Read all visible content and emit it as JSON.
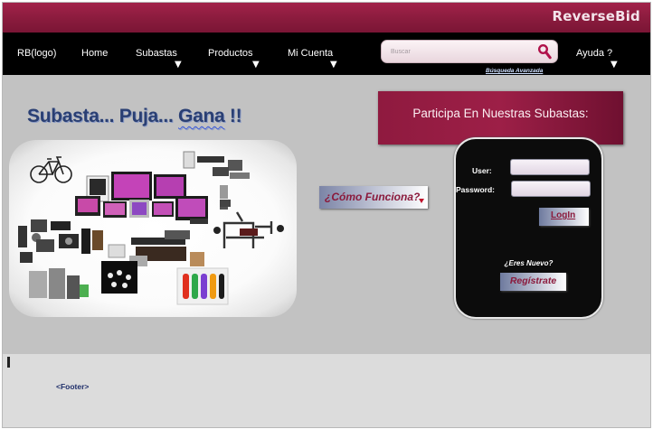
{
  "brand": {
    "name": "ReverseBid"
  },
  "nav": {
    "items": [
      {
        "label": "RB(logo)",
        "caret": false
      },
      {
        "label": "Home",
        "caret": false
      },
      {
        "label": "Subastas",
        "caret": true
      },
      {
        "label": "Productos",
        "caret": true
      },
      {
        "label": "Mi Cuenta",
        "caret": true
      },
      {
        "label": "Ayuda ?",
        "caret": true
      }
    ],
    "search": {
      "placeholder": "Buscar",
      "icon": "search-icon",
      "advanced_label": "Búsqueda  Avanzada"
    }
  },
  "hero": {
    "slogan_part1": "Subasta... Puja... ",
    "slogan_part2": "Gana",
    "slogan_part3": " !!",
    "como_funciona": "¿Cómo Funciona?",
    "participa": "Participa En Nuestras Subastas:"
  },
  "login": {
    "user_label": "User:",
    "password_label": "Password:",
    "user_value": "",
    "password_value": "",
    "login_button": "LogIn",
    "nuevo_text": "¿Eres Nuevo?",
    "register_button": "Regístrate"
  },
  "footer": {
    "label": "<Footer>"
  },
  "colors": {
    "brand_bar": "#8a1b3d",
    "nav_bg": "#000000",
    "hero_bg": "#c2c2c2",
    "accent_text": "#8b1a3c",
    "slogan": "#2a3f73"
  },
  "collage_items": [
    "bicycle",
    "televisions",
    "laptops",
    "tablets",
    "phones",
    "speakers",
    "camera",
    "furniture",
    "gym-machine",
    "dumbbells",
    "cooking-pots",
    "wristbands",
    "tools"
  ]
}
